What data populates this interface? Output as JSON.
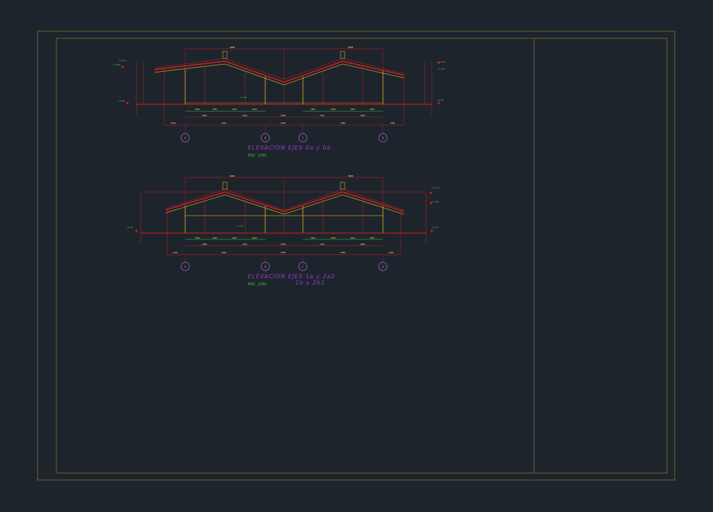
{
  "colors": {
    "background": "#1e242c",
    "frame": "#6a6a2a",
    "structure": "#e01e1e",
    "member": "#c8a020",
    "annotation": "#3ed43e",
    "dimension": "#ffe76a",
    "caption_title": "#9b3bd6",
    "caption_scale": "#3ed43e",
    "axis_bubble": "#b070e0"
  },
  "elevation_1": {
    "title": "ELEVACION EJES 0a y 0b",
    "scale": "ESC. 1/50",
    "axes": [
      "A",
      "B",
      "C",
      "D"
    ]
  },
  "elevation_2": {
    "title": "ELEVACION EJES 1a y 2a2",
    "title_line2": "1b y 2b1",
    "scale": "ESC. 1/50",
    "axes": [
      "A",
      "B",
      "C",
      "D"
    ]
  }
}
